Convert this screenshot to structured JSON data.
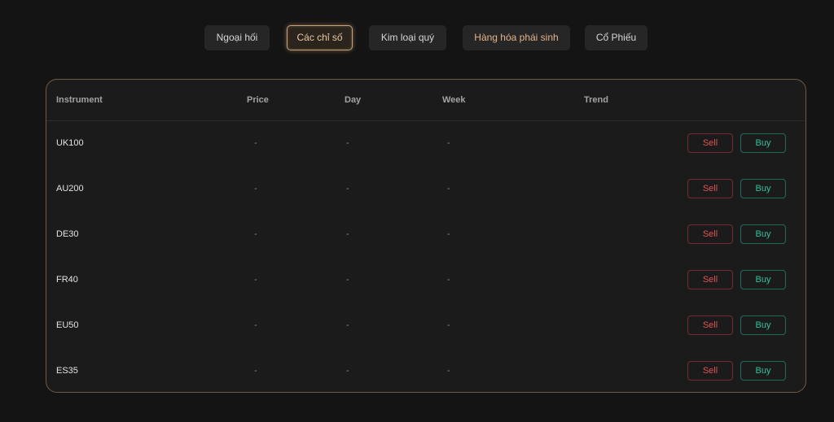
{
  "tabs": [
    {
      "label": "Ngoại hối",
      "active": false
    },
    {
      "label": "Các chỉ số",
      "active": true
    },
    {
      "label": "Kim loại quý",
      "active": false
    },
    {
      "label": "Hàng hóa phái sinh",
      "active": false
    },
    {
      "label": "Cổ Phiếu",
      "active": false
    }
  ],
  "table": {
    "headers": {
      "instrument": "Instrument",
      "price": "Price",
      "day": "Day",
      "week": "Week",
      "trend": "Trend"
    },
    "rows": [
      {
        "instrument": "UK100",
        "price": "-",
        "day": "-",
        "week": "-",
        "sell": "Sell",
        "buy": "Buy"
      },
      {
        "instrument": "AU200",
        "price": "-",
        "day": "-",
        "week": "-",
        "sell": "Sell",
        "buy": "Buy"
      },
      {
        "instrument": "DE30",
        "price": "-",
        "day": "-",
        "week": "-",
        "sell": "Sell",
        "buy": "Buy"
      },
      {
        "instrument": "FR40",
        "price": "-",
        "day": "-",
        "week": "-",
        "sell": "Sell",
        "buy": "Buy"
      },
      {
        "instrument": "EU50",
        "price": "-",
        "day": "-",
        "week": "-",
        "sell": "Sell",
        "buy": "Buy"
      },
      {
        "instrument": "ES35",
        "price": "-",
        "day": "-",
        "week": "-",
        "sell": "Sell",
        "buy": "Buy"
      }
    ]
  },
  "colors": {
    "background": "#141414",
    "panel": "#1b1b1b",
    "accent": "#c9a27a",
    "sell": "#e05252",
    "buy": "#2ec39e"
  }
}
